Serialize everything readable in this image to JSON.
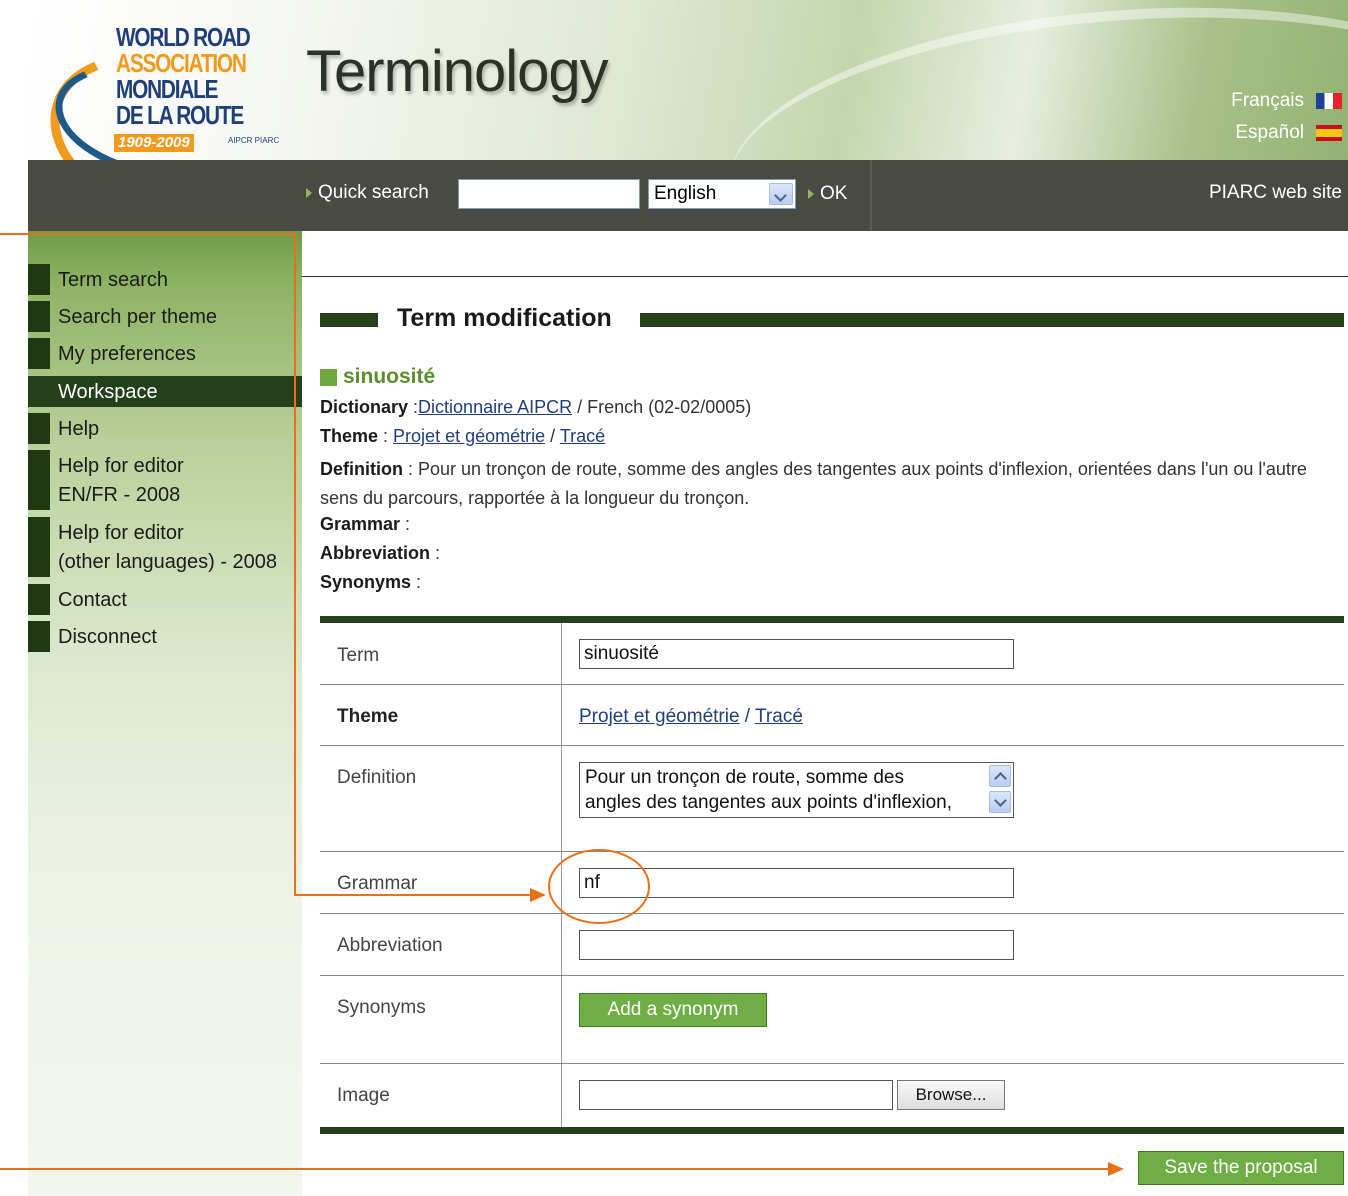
{
  "header": {
    "logo": {
      "line1": "WORLD ROAD",
      "line2": "ASSOCIATION",
      "line3": "MONDIALE",
      "line4": "DE LA ROUTE",
      "years": "1909-2009",
      "small": "AIPCR PIARC"
    },
    "title": "Terminology",
    "languages": [
      {
        "label": "Français",
        "flag": "flag-fr-icon"
      },
      {
        "label": "Español",
        "flag": "flag-es-icon"
      }
    ]
  },
  "toolbar": {
    "quick_search_label": "Quick search",
    "search_value": "",
    "language_selected": "English",
    "ok_label": "OK",
    "site_link": "PIARC web site"
  },
  "sidebar": {
    "items": [
      {
        "label": "Term search"
      },
      {
        "label": "Search per theme"
      },
      {
        "label": "My preferences"
      },
      {
        "label": "Workspace",
        "active": true
      },
      {
        "label": "Help"
      },
      {
        "label": "Help for editor",
        "label2": "EN/FR - 2008"
      },
      {
        "label": "Help for editor",
        "label2": "(other languages) - 2008"
      },
      {
        "label": "Contact"
      },
      {
        "label": "Disconnect"
      }
    ]
  },
  "main": {
    "section_title": "Term modification",
    "term": "sinuosité",
    "dictionary": {
      "label": "Dictionary",
      "link": "Dictionnaire AIPCR",
      "rest": "/ French (02-02/0005)"
    },
    "theme": {
      "label": "Theme",
      "link1": "Projet et géométrie",
      "link2": "Tracé"
    },
    "definition": {
      "label": "Definition",
      "text": "Pour un tronçon de route, somme des angles des tangentes aux points d'inflexion, orientées dans l'un ou l'autre sens du parcours, rapportée à la longueur du tronçon."
    },
    "grammar_label": "Grammar",
    "abbreviation_label": "Abbreviation",
    "synonyms_label": "Synonyms",
    "form": {
      "term_label": "Term",
      "term_value": "sinuosité",
      "theme_label": "Theme",
      "theme_link1": "Projet et géométrie",
      "theme_link2": "Tracé",
      "definition_label": "Definition",
      "definition_line1": "Pour un tronçon de route, somme des",
      "definition_line2": "angles des tangentes aux points d'inflexion,",
      "grammar_label": "Grammar",
      "grammar_value": "nf",
      "abbreviation_label": "Abbreviation",
      "abbreviation_value": "",
      "synonyms_label": "Synonyms",
      "add_synonym_label": "Add a synonym",
      "image_label": "Image",
      "browse_label": "Browse..."
    },
    "save_label": "Save the proposal"
  },
  "colors": {
    "dark_green": "#23401a",
    "button_green": "#6fae44",
    "annotation_orange": "#e8701a",
    "toolbar_gray": "#4a4a45"
  }
}
